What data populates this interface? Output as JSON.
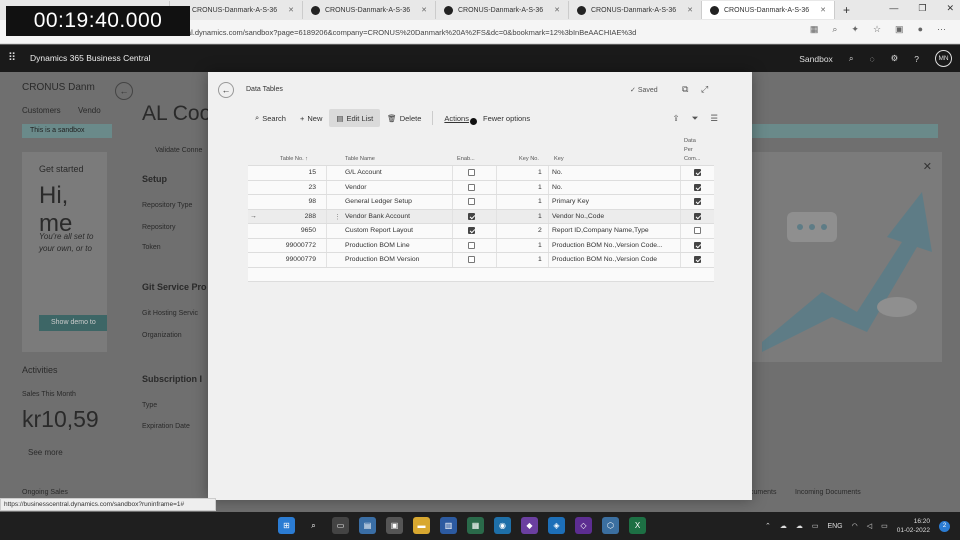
{
  "timer": "00:19:40.000",
  "browser": {
    "tabs": [
      {
        "title": ""
      },
      {
        "title": "CRONUS-Danmark-A-S-36"
      },
      {
        "title": "CRONUS-Danmark-A-S-36"
      },
      {
        "title": "CRONUS-Danmark-A-S-36"
      },
      {
        "title": "CRONUS-Danmark-A-S-36"
      },
      {
        "title": "CRONUS-Danmark-A-S-36"
      }
    ],
    "new_tab": "+",
    "url": "entral.dynamics.com/sandbox?page=6189206&company=CRONUS%20Danmark%20A%2FS&dc=0&bookmark=12%3bInBeAACHIAE%3d",
    "status_url": "https://businesscentral.dynamics.com/sandbox?runinframe=1#"
  },
  "app": {
    "title": "Dynamics 365 Business Central",
    "environment": "Sandbox",
    "user_initials": "MN"
  },
  "background": {
    "company": "CRONUS Danm",
    "nav": [
      "Customers",
      "Vendo"
    ],
    "banner": "This is a sandbox",
    "heading": "AL Coo",
    "validate": "Validate Conne",
    "setup": "Setup",
    "setup_fields": [
      "Repository Type",
      "Repository",
      "Token"
    ],
    "git_service": "Git Service Pro",
    "git_fields": [
      "Git Hosting Servic",
      "Organization"
    ],
    "subscription": "Subscription I",
    "sub_fields": [
      "Type",
      "Expiration Date"
    ],
    "get_started": "Get started",
    "hi": "Hi, me",
    "intro1": "You're all set to",
    "intro2": "your own, or to",
    "show_demo": "Show demo to",
    "activities": "Activities",
    "sales_month": "Sales This Month",
    "sales_value": "kr10,59",
    "see_more": "See more",
    "ongoing_sales": "Ongoing Sales",
    "documents": "cuments",
    "incoming_docs": "Incoming Documents"
  },
  "dialog": {
    "title": "Data Tables",
    "saved": "Saved",
    "toolbar": {
      "search": "Search",
      "new": "New",
      "edit_list": "Edit List",
      "delete": "Delete",
      "actions": "Actions",
      "fewer_options": "Fewer options"
    },
    "columns": {
      "table_no": "Table No. ↑",
      "table_name": "Table Name",
      "enabled": "Enab...",
      "key_no": "Key No.",
      "key": "Key",
      "data_per_company_1": "Data",
      "data_per_company_2": "Per",
      "data_per_company_3": "Com..."
    },
    "rows": [
      {
        "no": "15",
        "name": "G/L Account",
        "enabled": false,
        "key_no": "1",
        "key": "No.",
        "per_company": true
      },
      {
        "no": "23",
        "name": "Vendor",
        "enabled": false,
        "key_no": "1",
        "key": "No.",
        "per_company": true
      },
      {
        "no": "98",
        "name": "General Ledger Setup",
        "enabled": false,
        "key_no": "1",
        "key": "Primary Key",
        "per_company": true
      },
      {
        "no": "288",
        "name": "Vendor Bank Account",
        "enabled": true,
        "key_no": "1",
        "key": "Vendor No.,Code",
        "per_company": true
      },
      {
        "no": "9650",
        "name": "Custom Report Layout",
        "enabled": true,
        "key_no": "2",
        "key": "Report ID,Company Name,Type",
        "per_company": false
      },
      {
        "no": "99000772",
        "name": "Production BOM Line",
        "enabled": false,
        "key_no": "1",
        "key": "Production BOM No.,Version Code...",
        "per_company": true
      },
      {
        "no": "99000779",
        "name": "Production BOM Version",
        "enabled": false,
        "key_no": "1",
        "key": "Production BOM No.,Version Code",
        "per_company": true
      }
    ],
    "selected_row_marker": "→",
    "row_menu": "⋮"
  },
  "taskbar": {
    "lang": "ENG",
    "time": "16:20",
    "date": "01-02-2022",
    "notifications": "2"
  },
  "colors": {
    "header": "#1a1a1a",
    "dialog_bg": "#f0f0f0",
    "taskbar": "#1f1f1f"
  }
}
